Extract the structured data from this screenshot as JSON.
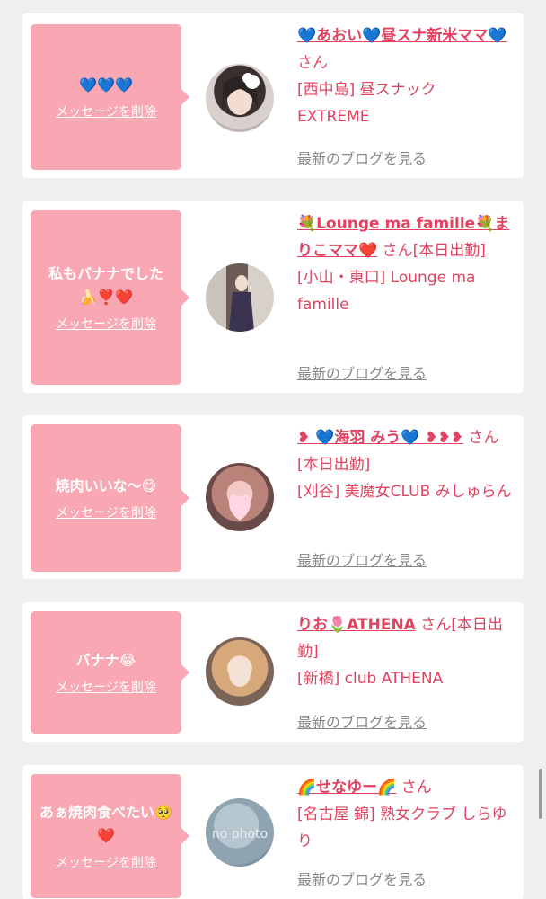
{
  "delete_label": "メッセージを削除",
  "blog_label": "最新のブログを見る",
  "cards": [
    {
      "message": "💙💙💙",
      "name": "💙あおい💙昼スナ新米ママ💙",
      "honorific": "さん",
      "area": "[西中島] 昼スナック EXTREME"
    },
    {
      "message": "私もバナナでした🍌❣️❤️",
      "name": "💐Lounge ma famille💐まりこママ❤️",
      "honorific": "さん[本日出勤]",
      "area": "[小山・東口] Lounge ma famille"
    },
    {
      "message": "焼肉いいな〜😋",
      "name": "❥ 💙海羽 みう💙 ❥❥❥",
      "honorific": "さん[本日出勤]",
      "area": "[刈谷] 美魔女CLUB みしゅらん"
    },
    {
      "message": "バナナ😂",
      "name": "りお🌷ATHENA",
      "honorific": "さん[本日出勤]",
      "area": "[新橋] club ATHENA"
    },
    {
      "message": "あぁ焼肉食べたい🥺❤️",
      "name": "🌈せなゆー🌈",
      "honorific": "さん",
      "area": "[名古屋 錦] 熟女クラブ しらゆり",
      "avatar_text": "no photo"
    }
  ]
}
